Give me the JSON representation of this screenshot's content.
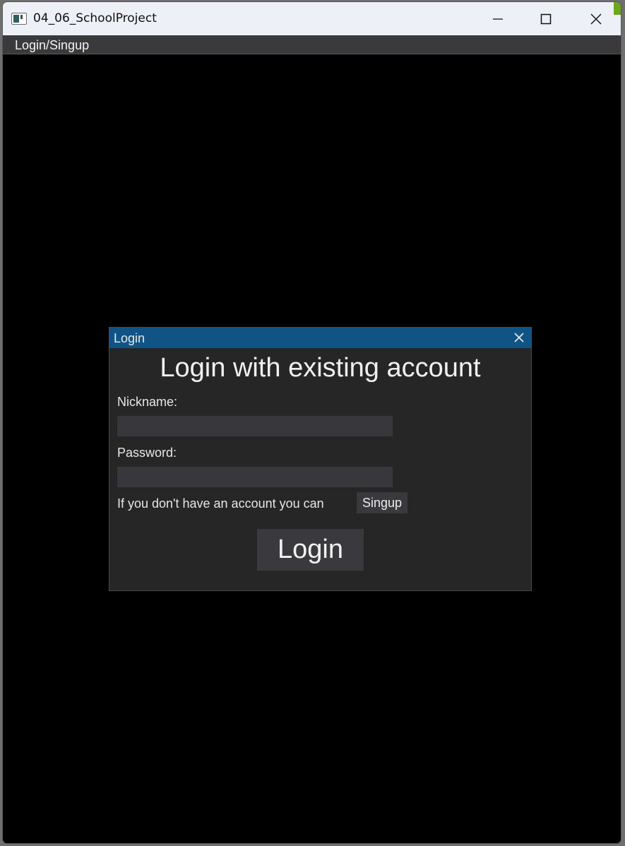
{
  "window": {
    "title": "04_06_SchoolProject"
  },
  "menubar": {
    "items": [
      {
        "label": "Login/Singup"
      }
    ]
  },
  "dialog": {
    "title": "Login",
    "heading": "Login with existing account",
    "nickname_label": "Nickname:",
    "nickname_value": "",
    "password_label": "Password:",
    "password_value": "",
    "signup_prompt": "If you don't have an account you can",
    "signup_button": "Singup",
    "login_button": "Login"
  },
  "colors": {
    "dialog_titlebar": "#0f5484",
    "dialog_background": "#262626",
    "window_background": "#000000",
    "titlebar_background": "#eef0f7"
  },
  "icons": [
    "app-icon",
    "minimize-icon",
    "maximize-icon",
    "close-icon",
    "dialog-close-icon"
  ]
}
